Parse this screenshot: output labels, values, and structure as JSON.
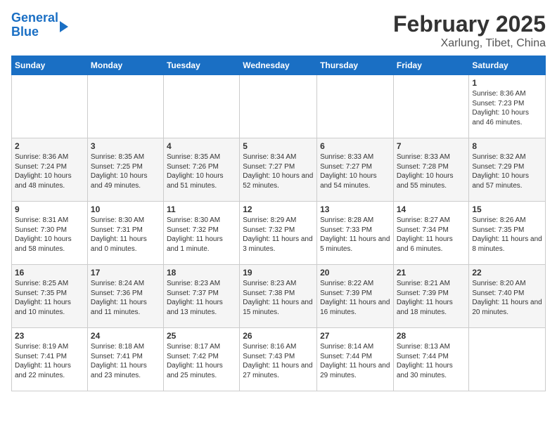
{
  "logo": {
    "line1": "General",
    "line2": "Blue"
  },
  "title": "February 2025",
  "subtitle": "Xarlung, Tibet, China",
  "weekdays": [
    "Sunday",
    "Monday",
    "Tuesday",
    "Wednesday",
    "Thursday",
    "Friday",
    "Saturday"
  ],
  "weeks": [
    [
      {
        "day": "",
        "info": ""
      },
      {
        "day": "",
        "info": ""
      },
      {
        "day": "",
        "info": ""
      },
      {
        "day": "",
        "info": ""
      },
      {
        "day": "",
        "info": ""
      },
      {
        "day": "",
        "info": ""
      },
      {
        "day": "1",
        "info": "Sunrise: 8:36 AM\nSunset: 7:23 PM\nDaylight: 10 hours and 46 minutes."
      }
    ],
    [
      {
        "day": "2",
        "info": "Sunrise: 8:36 AM\nSunset: 7:24 PM\nDaylight: 10 hours and 48 minutes."
      },
      {
        "day": "3",
        "info": "Sunrise: 8:35 AM\nSunset: 7:25 PM\nDaylight: 10 hours and 49 minutes."
      },
      {
        "day": "4",
        "info": "Sunrise: 8:35 AM\nSunset: 7:26 PM\nDaylight: 10 hours and 51 minutes."
      },
      {
        "day": "5",
        "info": "Sunrise: 8:34 AM\nSunset: 7:27 PM\nDaylight: 10 hours and 52 minutes."
      },
      {
        "day": "6",
        "info": "Sunrise: 8:33 AM\nSunset: 7:27 PM\nDaylight: 10 hours and 54 minutes."
      },
      {
        "day": "7",
        "info": "Sunrise: 8:33 AM\nSunset: 7:28 PM\nDaylight: 10 hours and 55 minutes."
      },
      {
        "day": "8",
        "info": "Sunrise: 8:32 AM\nSunset: 7:29 PM\nDaylight: 10 hours and 57 minutes."
      }
    ],
    [
      {
        "day": "9",
        "info": "Sunrise: 8:31 AM\nSunset: 7:30 PM\nDaylight: 10 hours and 58 minutes."
      },
      {
        "day": "10",
        "info": "Sunrise: 8:30 AM\nSunset: 7:31 PM\nDaylight: 11 hours and 0 minutes."
      },
      {
        "day": "11",
        "info": "Sunrise: 8:30 AM\nSunset: 7:32 PM\nDaylight: 11 hours and 1 minute."
      },
      {
        "day": "12",
        "info": "Sunrise: 8:29 AM\nSunset: 7:32 PM\nDaylight: 11 hours and 3 minutes."
      },
      {
        "day": "13",
        "info": "Sunrise: 8:28 AM\nSunset: 7:33 PM\nDaylight: 11 hours and 5 minutes."
      },
      {
        "day": "14",
        "info": "Sunrise: 8:27 AM\nSunset: 7:34 PM\nDaylight: 11 hours and 6 minutes."
      },
      {
        "day": "15",
        "info": "Sunrise: 8:26 AM\nSunset: 7:35 PM\nDaylight: 11 hours and 8 minutes."
      }
    ],
    [
      {
        "day": "16",
        "info": "Sunrise: 8:25 AM\nSunset: 7:35 PM\nDaylight: 11 hours and 10 minutes."
      },
      {
        "day": "17",
        "info": "Sunrise: 8:24 AM\nSunset: 7:36 PM\nDaylight: 11 hours and 11 minutes."
      },
      {
        "day": "18",
        "info": "Sunrise: 8:23 AM\nSunset: 7:37 PM\nDaylight: 11 hours and 13 minutes."
      },
      {
        "day": "19",
        "info": "Sunrise: 8:23 AM\nSunset: 7:38 PM\nDaylight: 11 hours and 15 minutes."
      },
      {
        "day": "20",
        "info": "Sunrise: 8:22 AM\nSunset: 7:39 PM\nDaylight: 11 hours and 16 minutes."
      },
      {
        "day": "21",
        "info": "Sunrise: 8:21 AM\nSunset: 7:39 PM\nDaylight: 11 hours and 18 minutes."
      },
      {
        "day": "22",
        "info": "Sunrise: 8:20 AM\nSunset: 7:40 PM\nDaylight: 11 hours and 20 minutes."
      }
    ],
    [
      {
        "day": "23",
        "info": "Sunrise: 8:19 AM\nSunset: 7:41 PM\nDaylight: 11 hours and 22 minutes."
      },
      {
        "day": "24",
        "info": "Sunrise: 8:18 AM\nSunset: 7:41 PM\nDaylight: 11 hours and 23 minutes."
      },
      {
        "day": "25",
        "info": "Sunrise: 8:17 AM\nSunset: 7:42 PM\nDaylight: 11 hours and 25 minutes."
      },
      {
        "day": "26",
        "info": "Sunrise: 8:16 AM\nSunset: 7:43 PM\nDaylight: 11 hours and 27 minutes."
      },
      {
        "day": "27",
        "info": "Sunrise: 8:14 AM\nSunset: 7:44 PM\nDaylight: 11 hours and 29 minutes."
      },
      {
        "day": "28",
        "info": "Sunrise: 8:13 AM\nSunset: 7:44 PM\nDaylight: 11 hours and 30 minutes."
      },
      {
        "day": "",
        "info": ""
      }
    ]
  ]
}
